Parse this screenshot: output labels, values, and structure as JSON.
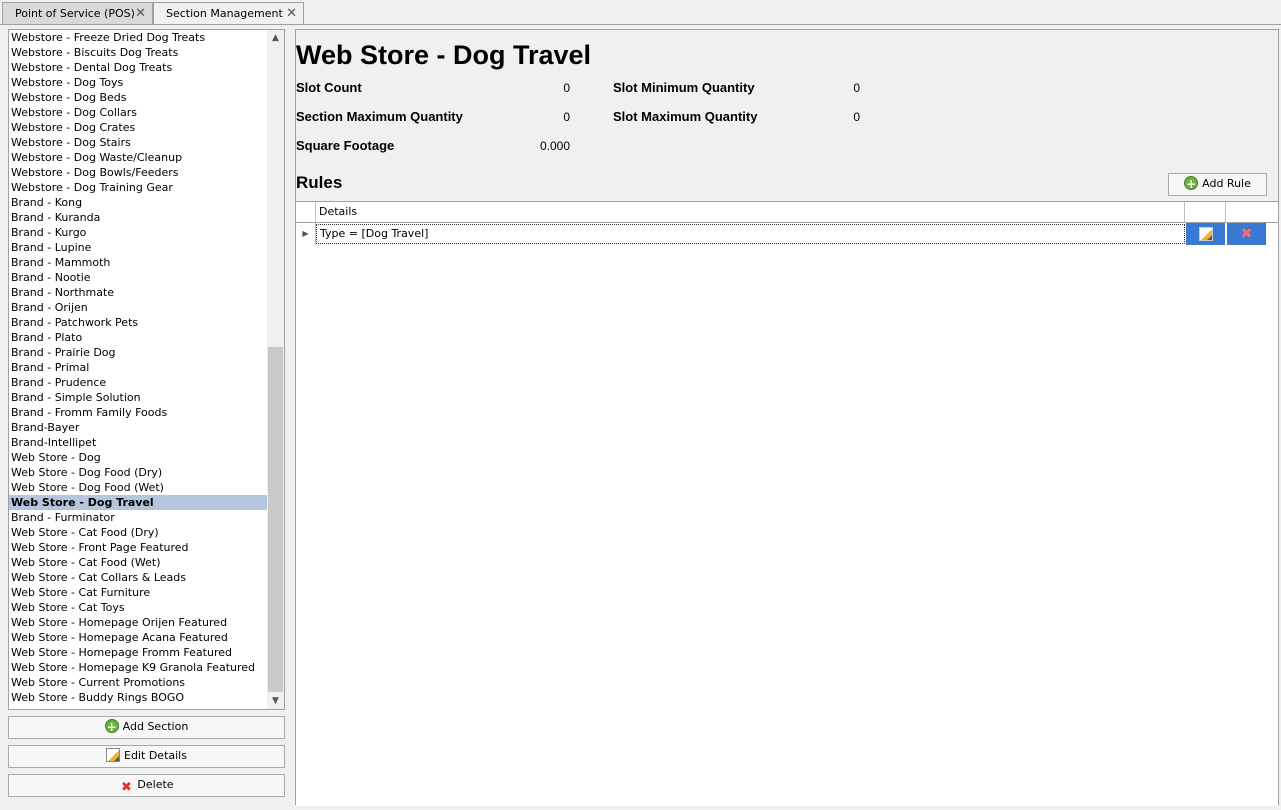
{
  "tabs": [
    {
      "label": "Point of Service (POS)"
    },
    {
      "label": "Section Management"
    }
  ],
  "sections": [
    "Webstore - Freeze Dried Dog Treats",
    "Webstore - Biscuits Dog Treats",
    "Webstore - Dental Dog Treats",
    "Webstore - Dog Toys",
    "Webstore - Dog Beds",
    "Webstore - Dog Collars",
    "Webstore - Dog Crates",
    "Webstore - Dog Stairs",
    "Webstore - Dog Waste/Cleanup",
    "Webstore - Dog Bowls/Feeders",
    "Webstore - Dog Training Gear",
    "Brand - Kong",
    "Brand - Kuranda",
    "Brand - Kurgo",
    "Brand - Lupine",
    "Brand - Mammoth",
    "Brand - Nootie",
    "Brand - Northmate",
    "Brand - Orijen",
    "Brand - Patchwork Pets",
    "Brand - Plato",
    "Brand - Prairie Dog",
    "Brand - Primal",
    "Brand - Prudence",
    "Brand - Simple Solution",
    "Brand - Fromm Family Foods",
    "Brand-Bayer",
    "Brand-Intellipet",
    "Web Store - Dog",
    "Web Store - Dog Food (Dry)",
    "Web Store - Dog Food (Wet)",
    "Web Store - Dog Travel",
    "Brand - Furminator",
    "Web Store - Cat Food (Dry)",
    "Web Store - Front Page Featured",
    "Web Store - Cat Food (Wet)",
    "Web Store - Cat Collars & Leads",
    "Web Store - Cat Furniture",
    "Web Store - Cat Toys",
    "Web Store - Homepage Orijen Featured",
    "Web Store - Homepage Acana Featured",
    "Web Store - Homepage Fromm Featured",
    "Web Store - Homepage K9 Granola Featured",
    "Web Store - Current Promotions",
    "Web Store - Buddy Rings BOGO"
  ],
  "selected_section": "Web Store - Dog Travel",
  "left_buttons": {
    "add": "Add Section",
    "edit": "Edit Details",
    "delete": "Delete"
  },
  "detail": {
    "title": "Web Store - Dog Travel",
    "slot_count_label": "Slot Count",
    "slot_count": "0",
    "slot_min_label": "Slot Minimum Quantity",
    "slot_min": "0",
    "section_max_label": "Section Maximum Quantity",
    "section_max": "0",
    "slot_max_label": "Slot Maximum Quantity",
    "slot_max": "0",
    "sqft_label": "Square Footage",
    "sqft": "0.000"
  },
  "rules": {
    "title": "Rules",
    "add_label": "Add Rule",
    "column_details": "Details",
    "rows": [
      {
        "details": "Type = [Dog Travel]"
      }
    ]
  },
  "colors": {
    "selected_row": "#b4c6de",
    "row_action_bg": "#3a79d3"
  }
}
